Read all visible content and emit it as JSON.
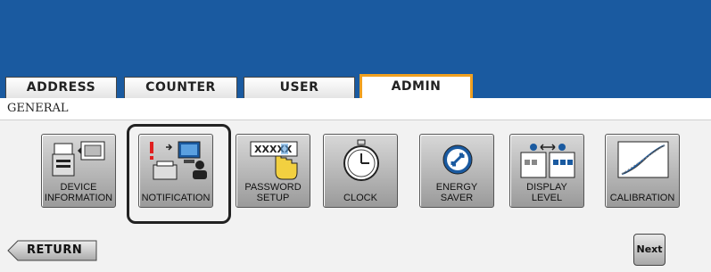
{
  "tabs": [
    {
      "label": "ADDRESS"
    },
    {
      "label": "COUNTER"
    },
    {
      "label": "USER"
    },
    {
      "label": "ADMIN",
      "active": true
    }
  ],
  "section_label": "GENERAL",
  "buttons": [
    {
      "label": "DEVICE\nINFORMATION",
      "icon": "device-information-icon"
    },
    {
      "label": "NOTIFICATION",
      "icon": "notification-icon",
      "selected": true
    },
    {
      "label": "PASSWORD SETUP",
      "icon": "password-setup-icon"
    },
    {
      "label": "CLOCK",
      "icon": "clock-icon"
    },
    {
      "label": "ENERGY\nSAVER",
      "icon": "energy-saver-icon"
    },
    {
      "label": "DISPLAY LEVEL",
      "icon": "display-level-icon"
    },
    {
      "label": "CALIBRATION",
      "icon": "calibration-icon"
    }
  ],
  "password_icon_text": "XXXXX",
  "return_label": "RETURN",
  "next_label": "Next",
  "colors": {
    "header": "#1a5aa0",
    "active_tab_border": "#f0a020"
  }
}
